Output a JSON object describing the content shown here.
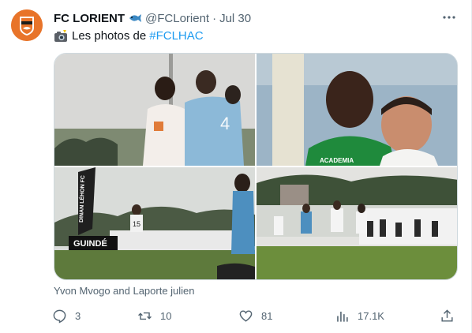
{
  "tweet": {
    "author_name": "FC LORIENT",
    "handle": "@FCLorient",
    "separator": "·",
    "date": "Jul 30",
    "text": "Les photos de",
    "hashtag": "#FCLHAC",
    "caption": "Yvon Mvogo and Laporte julien",
    "avatar_text": "FC LORIENT",
    "icons": {
      "author_badge": "fish-emoji-icon",
      "text_emoji": "camera-flash-icon",
      "more": "more-horizontal-icon"
    },
    "photos": [
      {
        "description_icon": "photo-players-icon"
      },
      {
        "description_icon": "photo-goalkeeper-icon"
      },
      {
        "description_icon": "photo-stadium-icon"
      },
      {
        "description_icon": "photo-match-icon"
      }
    ],
    "banner_texts": {
      "board": "GUINDÉ",
      "flag": "DINAN LÉHON FC",
      "jersey_back": "15",
      "shirt_sponsor": "ACADEMIA"
    },
    "actions": {
      "replies": "3",
      "retweets": "10",
      "likes": "81",
      "views": "17.1K"
    }
  },
  "colors": {
    "accent": "#1d9bf0",
    "secondary_text": "#536471",
    "lorient_orange": "#e8742a"
  }
}
